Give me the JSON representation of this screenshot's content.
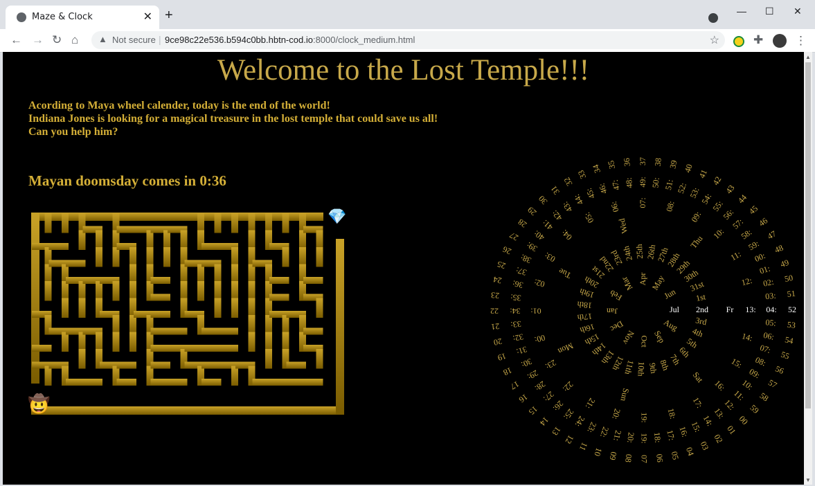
{
  "browser": {
    "tab_title": "Maze & Clock",
    "security_label": "Not secure",
    "url_host": "9ce98c22e536.b594c0bb.hbtn-cod.io",
    "url_path": ":8000/clock_medium.html"
  },
  "page": {
    "title": "Welcome to the Lost Temple!!!",
    "intro_lines": [
      "Acording to Maya wheel calender, today is the end of the world!",
      "Indiana Jones is looking for a magical treasure in the lost temple that could save us all!",
      "Can you help him?"
    ],
    "countdown": "Mayan doomsday comes in 0:36"
  },
  "maze": {
    "goal_icon": "gem-icon",
    "player_icon": "cowboy-icon",
    "gradient_top": "#c9a227",
    "gradient_bottom": "#7a5c00"
  },
  "clock": {
    "active_color": "#ffffff",
    "inactive_color": "#c8a94a",
    "months": [
      "Jan",
      "Feb",
      "Mar",
      "Apr",
      "May",
      "Jun",
      "Jul",
      "Aug",
      "Sep",
      "Oct",
      "Nov",
      "Dec"
    ],
    "active_month": "Jul",
    "days": [
      "1st",
      "2nd",
      "3rd",
      "4th",
      "5th",
      "6th",
      "7th",
      "8th",
      "9th",
      "10th",
      "11th",
      "12th",
      "13th",
      "14th",
      "15th",
      "16th",
      "17th",
      "18th",
      "19th",
      "20th",
      "21st",
      "22nd",
      "23rd",
      "24th",
      "25th",
      "26th",
      "27th",
      "28th",
      "29th",
      "30th",
      "31st"
    ],
    "active_day": "2nd",
    "weekdays": [
      "Mon",
      "Tue",
      "Wed",
      "Thu",
      "Fr",
      "Sat",
      "Sun"
    ],
    "active_weekday": "Fr",
    "hours": [
      "00:",
      "01:",
      "02:",
      "03:",
      "04:",
      "05:",
      "06:",
      "07:",
      "08:",
      "09:",
      "10:",
      "11:",
      "12:",
      "13:",
      "14:",
      "15:",
      "16:",
      "17:",
      "18:",
      "19:",
      "20:",
      "21:",
      "22:",
      "23:"
    ],
    "active_hour": "13:",
    "minutes": [
      "00:",
      "01:",
      "02:",
      "03:",
      "04:",
      "05:",
      "06:",
      "07:",
      "08:",
      "09:",
      "10:",
      "11:",
      "12:",
      "13:",
      "14:",
      "15:",
      "16:",
      "17:",
      "18:",
      "19:",
      "20:",
      "21:",
      "22:",
      "23:",
      "24:",
      "25:",
      "26:",
      "27:",
      "28:",
      "29:",
      "30:",
      "31:",
      "32:",
      "33:",
      "34:",
      "35:",
      "36:",
      "37:",
      "38:",
      "39:",
      "40:",
      "41:",
      "42:",
      "43:",
      "44:",
      "45:",
      "46:",
      "47:",
      "48:",
      "49:",
      "50:",
      "51:",
      "52:",
      "53:",
      "54:",
      "55:",
      "56:",
      "57:",
      "58:",
      "59:"
    ],
    "active_minute": "04:",
    "seconds": [
      "00",
      "01",
      "02",
      "03",
      "04",
      "05",
      "06",
      "07",
      "08",
      "09",
      "10",
      "11",
      "12",
      "13",
      "14",
      "15",
      "16",
      "17",
      "18",
      "19",
      "20",
      "21",
      "22",
      "23",
      "24",
      "25",
      "26",
      "27",
      "28",
      "29",
      "30",
      "31",
      "32",
      "33",
      "34",
      "35",
      "36",
      "37",
      "38",
      "39",
      "40",
      "41",
      "42",
      "43",
      "44",
      "45",
      "46",
      "47",
      "48",
      "49",
      "50",
      "51",
      "52",
      "53",
      "54",
      "55",
      "56",
      "57",
      "58",
      "59"
    ],
    "active_second": "52"
  }
}
